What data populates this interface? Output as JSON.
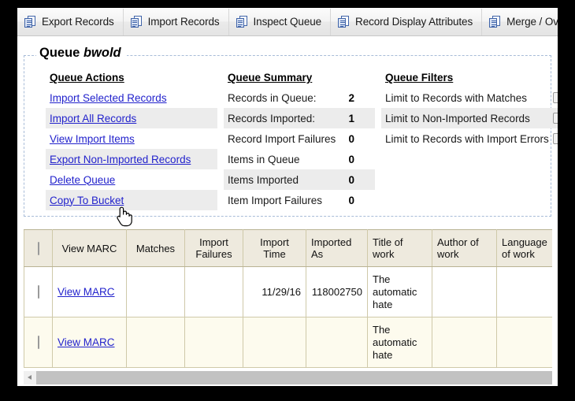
{
  "toolbar": {
    "icon": "copy-documents-icon",
    "items": [
      {
        "label": "Export Records"
      },
      {
        "label": "Import Records"
      },
      {
        "label": "Inspect Queue"
      },
      {
        "label": "Record Display Attributes"
      },
      {
        "label": "Merge / Overlay Profiles"
      }
    ]
  },
  "queue": {
    "legend_prefix": "Queue",
    "legend_name": "bwold",
    "actions": {
      "heading": "Queue Actions",
      "items": [
        {
          "label": "Import Selected Records"
        },
        {
          "label": "Import All Records"
        },
        {
          "label": "View Import Items"
        },
        {
          "label": "Export Non-Imported Records"
        },
        {
          "label": "Delete Queue"
        },
        {
          "label": "Copy To Bucket"
        }
      ]
    },
    "summary": {
      "heading": "Queue Summary",
      "rows": [
        {
          "label": "Records in Queue:",
          "value": "2"
        },
        {
          "label": "Records Imported:",
          "value": "1"
        },
        {
          "label": "Record Import Failures",
          "value": "0"
        },
        {
          "label": "Items in Queue",
          "value": "0"
        },
        {
          "label": "Items Imported",
          "value": "0"
        },
        {
          "label": "Item Import Failures",
          "value": "0"
        }
      ]
    },
    "filters": {
      "heading": "Queue Filters",
      "rows": [
        {
          "label": "Limit to Records with Matches",
          "checked": false
        },
        {
          "label": "Limit to Non-Imported Records",
          "checked": false
        },
        {
          "label": "Limit to Records with Import Errors",
          "checked": false
        }
      ]
    }
  },
  "records_table": {
    "headers": [
      "",
      "View MARC",
      "Matches",
      "Import Failures",
      "Import Time",
      "Imported As",
      "Title of work",
      "Author of work",
      "Language of work"
    ],
    "rows": [
      {
        "view_marc": "View MARC",
        "matches": "",
        "import_failures": "",
        "import_time": "11/29/16",
        "imported_as": "118002750",
        "title": "The automatic hate",
        "author": "",
        "language": ""
      },
      {
        "view_marc": "View MARC",
        "matches": "",
        "import_failures": "",
        "import_time": "",
        "imported_as": "",
        "title": "The automatic hate",
        "author": "",
        "language": ""
      }
    ]
  },
  "scrollbar": {
    "left_arrow": "scroll-left-arrow"
  },
  "colors": {
    "link": "#2222cc",
    "header_bg": "#eeeade",
    "alt_row": "#fdfbee",
    "fieldset_border": "#a8bcd8"
  }
}
